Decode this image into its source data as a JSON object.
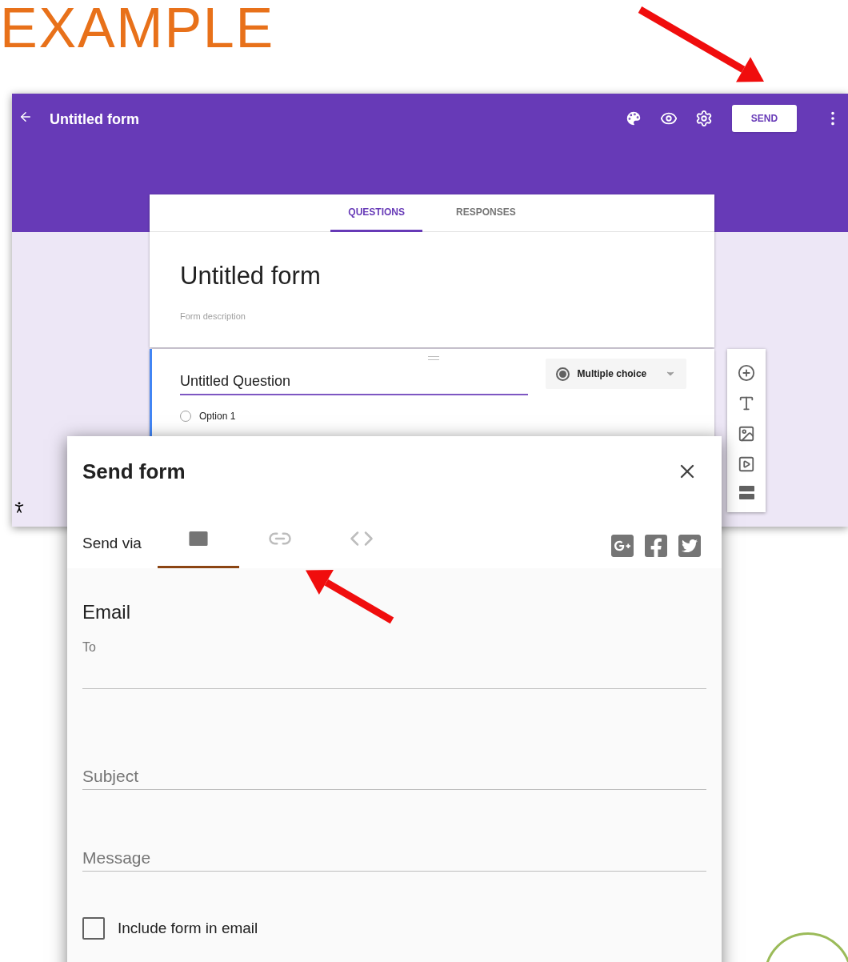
{
  "slide": {
    "title": "EXAMPLE"
  },
  "app": {
    "title": "Untitled form",
    "send_button": "SEND",
    "tabs": [
      {
        "label": "QUESTIONS",
        "selected": true
      },
      {
        "label": "RESPONSES",
        "selected": false
      }
    ],
    "form_title": "Untitled form",
    "form_description": "Form description",
    "question": {
      "title": "Untitled Question",
      "type": "Multiple choice",
      "options": [
        {
          "label": "Option 1",
          "selected": false
        }
      ]
    }
  },
  "dialog": {
    "title": "Send form",
    "send_via": "Send via",
    "methods": [
      {
        "kind": "email",
        "selected": true
      },
      {
        "kind": "link",
        "selected": false
      },
      {
        "kind": "embed",
        "selected": false
      }
    ],
    "heading": "Email",
    "fields": [
      {
        "label": "To"
      },
      {
        "placeholder": "Subject"
      },
      {
        "placeholder": "Message"
      }
    ],
    "include_form": {
      "label": "Include form in email",
      "checked": false
    }
  }
}
